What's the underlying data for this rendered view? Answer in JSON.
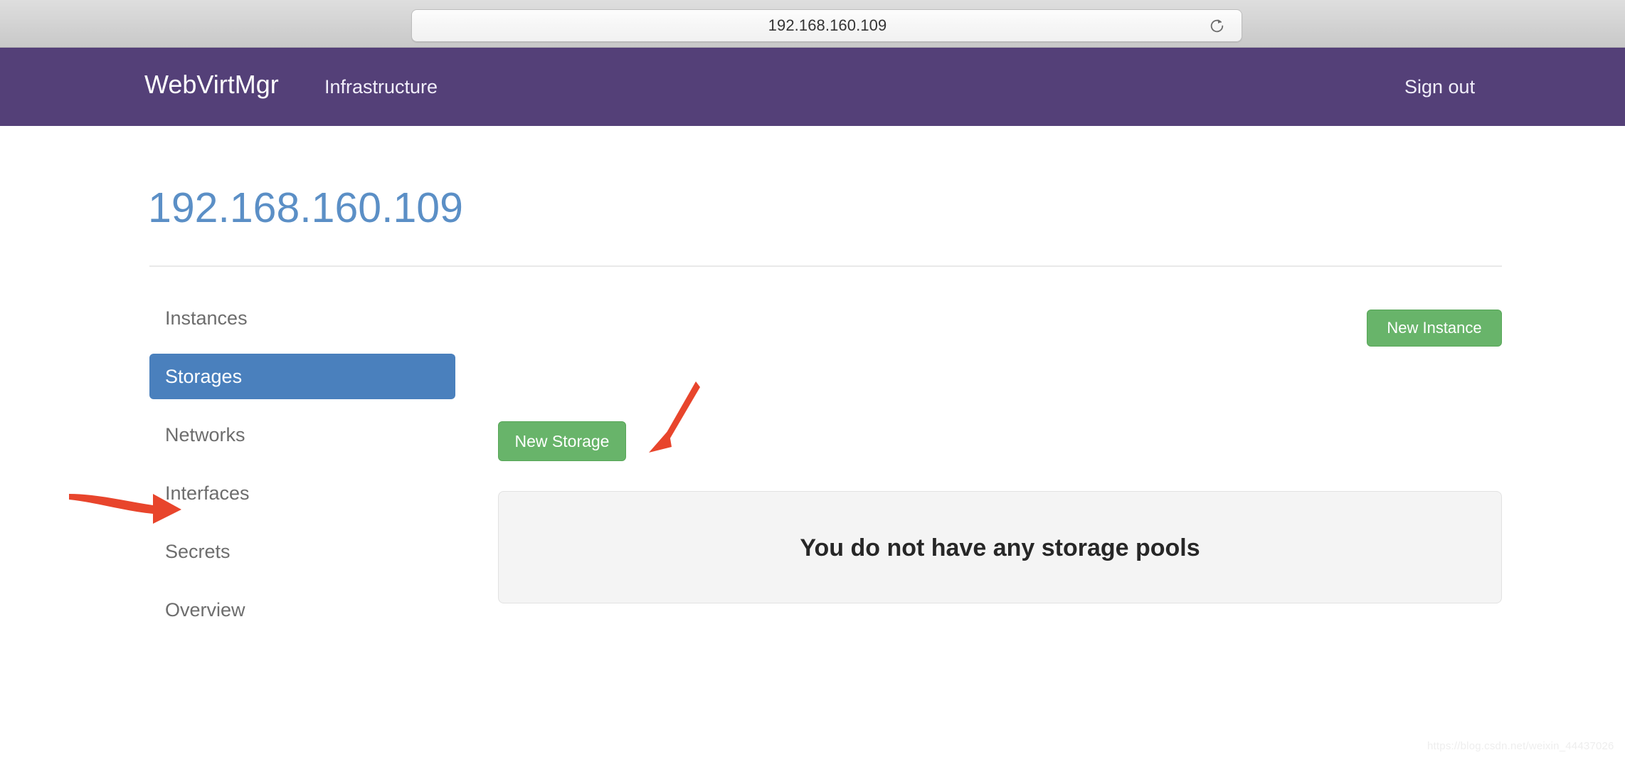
{
  "browser": {
    "url": "192.168.160.109",
    "reload_icon": "reload-icon"
  },
  "navbar": {
    "brand": "WebVirtMgr",
    "infrastructure_label": "Infrastructure",
    "signout_label": "Sign out",
    "background_color": "#544078"
  },
  "header": {
    "title": "192.168.160.109",
    "title_color": "#5b8fc6",
    "new_instance_label": "New Instance",
    "new_instance_color": "#68b46a"
  },
  "sidebar": {
    "items": [
      {
        "label": "Instances",
        "active": false
      },
      {
        "label": "Storages",
        "active": true
      },
      {
        "label": "Networks",
        "active": false
      },
      {
        "label": "Interfaces",
        "active": false
      },
      {
        "label": "Secrets",
        "active": false
      },
      {
        "label": "Overview",
        "active": false
      }
    ],
    "active_color": "#4a80bd"
  },
  "main": {
    "new_storage_label": "New Storage",
    "new_storage_color": "#68b46a",
    "empty_message": "You do not have any storage pools"
  },
  "annotations": {
    "color": "#e8452c",
    "arrow_to_sidebar": "arrow-right-icon",
    "arrow_to_new_storage": "arrow-down-left-icon"
  },
  "watermark": {
    "text": "https://blog.csdn.net/weixin_44437026"
  }
}
